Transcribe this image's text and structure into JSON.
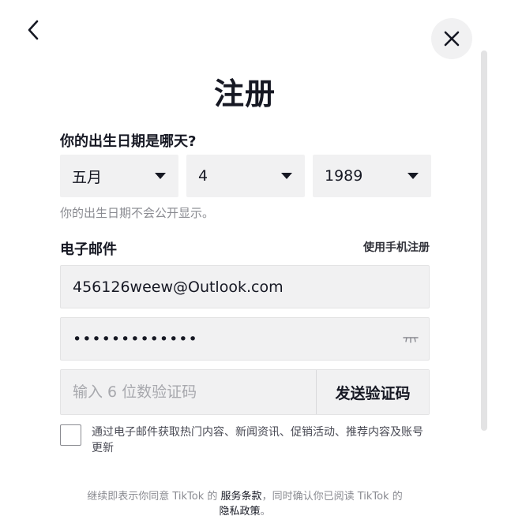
{
  "header": {
    "title": "注册",
    "back_icon": "chevron-left-icon",
    "close_icon": "close-icon"
  },
  "dob": {
    "label": "你的出生日期是哪天?",
    "month": "五月",
    "day": "4",
    "year": "1989",
    "hint": "你的出生日期不会公开显示。"
  },
  "email": {
    "label": "电子邮件",
    "switch_label": "使用手机注册",
    "value": "456126weew@Outlook.com"
  },
  "password": {
    "value": "•••••••••••••",
    "toggle_icon": "eye-closed-icon"
  },
  "code": {
    "placeholder": "输入 6 位数验证码",
    "send_label": "发送验证码"
  },
  "consent": {
    "text": "通过电子邮件获取热门内容、新闻资讯、促销活动、推荐内容及账号更新",
    "checked": false
  },
  "footer": {
    "prefix": "继续即表示你同意 TikTok 的 ",
    "terms_link": "服务条款",
    "middle": "，同时确认你已阅读 TikTok 的",
    "privacy_link": "隐私政策",
    "suffix": "。"
  },
  "colors": {
    "text": "#161823",
    "field_bg": "#f1f1f2",
    "muted": "#8a8b91"
  }
}
